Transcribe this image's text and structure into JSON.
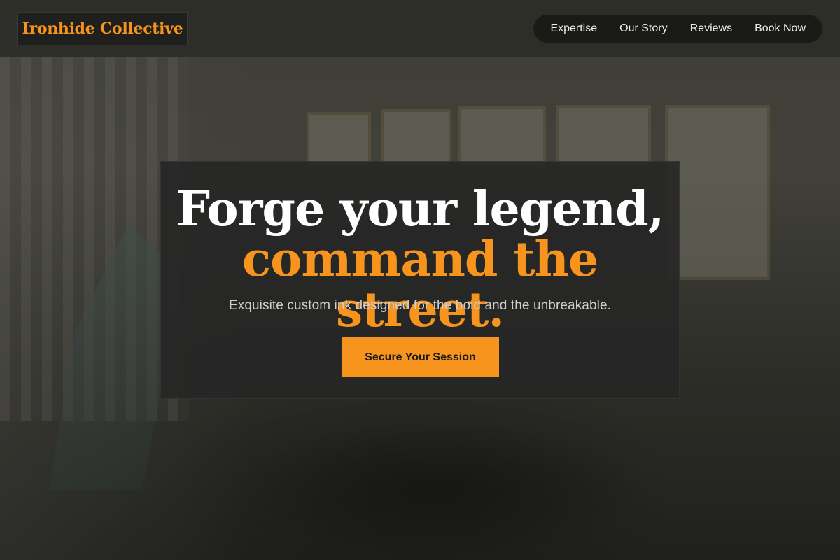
{
  "brand": {
    "name": "Ironhide Collective",
    "accent_color": "#f7941d"
  },
  "nav": {
    "items": [
      {
        "label": "Expertise"
      },
      {
        "label": "Our Story"
      },
      {
        "label": "Reviews"
      },
      {
        "label": "Book Now"
      }
    ]
  },
  "hero": {
    "headline_line1": "Forge your legend,",
    "headline_line2": "command the street.",
    "subtitle": "Exquisite custom ink designed for the bold and the unbreakable.",
    "cta_label": "Secure Your Session"
  },
  "colors": {
    "header_bg": "#2c2c28",
    "nav_bg": "#1a1a19",
    "card_bg": "#262626",
    "headline_white": "#ffffff"
  }
}
